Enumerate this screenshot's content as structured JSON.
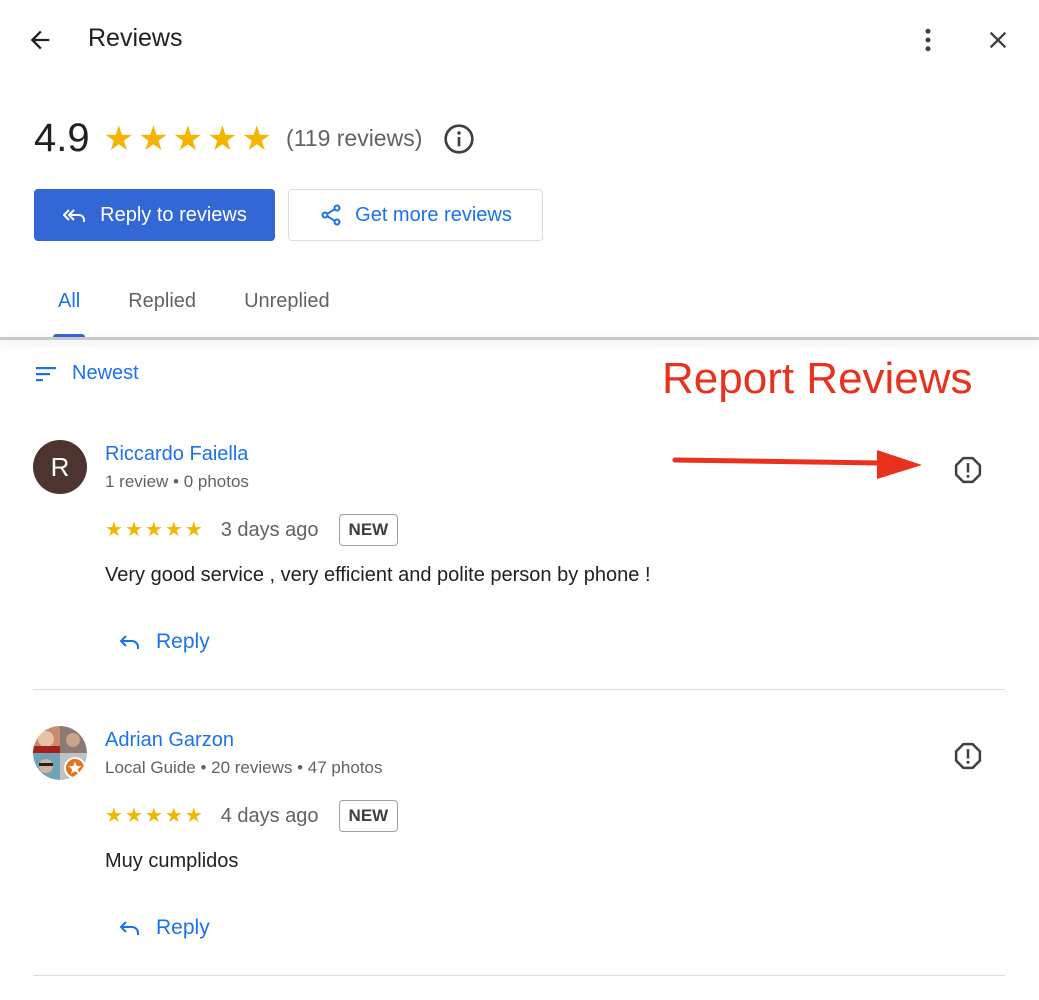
{
  "header": {
    "title": "Reviews",
    "back_icon": "arrow-back-icon",
    "more_icon": "more-vert-icon",
    "close_icon": "close-icon"
  },
  "summary": {
    "rating": "4.9",
    "stars": 5,
    "review_count": "(119 reviews)",
    "info_icon": "info-icon"
  },
  "actions": {
    "reply_to_reviews": "Reply to reviews",
    "get_more_reviews": "Get more reviews"
  },
  "tabs": [
    {
      "label": "All",
      "active": true
    },
    {
      "label": "Replied",
      "active": false
    },
    {
      "label": "Unreplied",
      "active": false
    }
  ],
  "sort": {
    "label": "Newest",
    "icon": "sort-icon"
  },
  "annotation": {
    "text": "Report Reviews",
    "color": "#e8321d"
  },
  "colors": {
    "accent": "#1a73e8",
    "primary_button": "#3367d6",
    "star": "#f4b400"
  },
  "reviews": [
    {
      "name": "Riccardo Faiella",
      "avatar_letter": "R",
      "meta": "1 review • 0 photos",
      "stars": 5,
      "date": "3 days ago",
      "badge": "NEW",
      "text": "Very good service , very efficient and polite person by phone !",
      "reply_label": "Reply"
    },
    {
      "name": "Adrian Garzon",
      "avatar_letter": "",
      "meta": "Local Guide • 20 reviews • 47 photos",
      "stars": 5,
      "date": "4 days ago",
      "badge": "NEW",
      "text": "Muy cumplidos",
      "reply_label": "Reply"
    }
  ]
}
